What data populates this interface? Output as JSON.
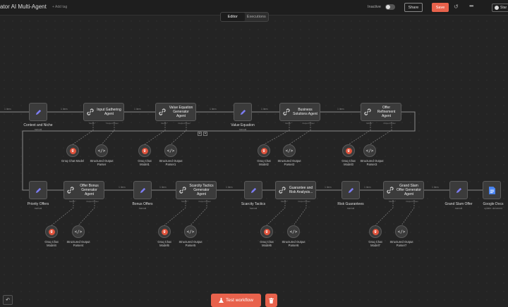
{
  "header": {
    "title": "ator AI Multi-Agent",
    "add_tag": "+ Add tag",
    "status": "Inactive",
    "share": "Share",
    "save": "Save",
    "github": "Star"
  },
  "tabs": {
    "editor": "Editor",
    "executions": "Executions"
  },
  "row1": {
    "set1": {
      "title": "Context and Niche",
      "sub": "manual"
    },
    "agent1": "Input Gathering Agent",
    "agent2": "Value Equation Generator Agent",
    "set2": {
      "title": "Value Equation",
      "sub": "manual"
    },
    "agent3": "Business Solutions Agent",
    "agent4": "Offer Refinement Agent"
  },
  "row2": {
    "set1": {
      "title": "Priority Offers",
      "sub": "manual"
    },
    "agent1": "Offer Bonus Generator Agent",
    "set2": {
      "title": "Bonus Offers",
      "sub": "manual"
    },
    "agent2": "Scarcity Tactics Generator Agent",
    "set3": {
      "title": "Scarcity Tactics",
      "sub": "manual"
    },
    "agent3": "Guarantee and Risk Analysis...",
    "set4": {
      "title": "Risk Guarantees",
      "sub": "manual"
    },
    "agent4": "Grand Slam Offer Generator Agent",
    "set5": {
      "title": "Grand Slam Offer",
      "sub": "manual"
    },
    "gdoc": {
      "title": "Google Docs",
      "sub": "update: document"
    }
  },
  "ports": {
    "model": "Model *",
    "parser": "Output Parser"
  },
  "conn_label": "1 item",
  "subnodes": {
    "groq": [
      "Groq Chat Model",
      "Groq Chat Model1",
      "Groq Chat Model2",
      "Groq Chat Model3",
      "Groq Chat Model4",
      "Groq Chat Model5",
      "Groq Chat Model6",
      "Groq Chat Model7"
    ],
    "parser": [
      "Structured Output Parser",
      "Structured Output Parser1",
      "Structured Output Parser2",
      "Structured Output Parser3",
      "Structured Output Parser4",
      "Structured Output Parser5",
      "Structured Output Parser6",
      "Structured Output Parser7"
    ]
  },
  "footer": {
    "test_workflow": "Test workflow"
  },
  "colors": {
    "accent": "#e8624c",
    "canvas": "#242424",
    "node": "#3b3b3b"
  }
}
